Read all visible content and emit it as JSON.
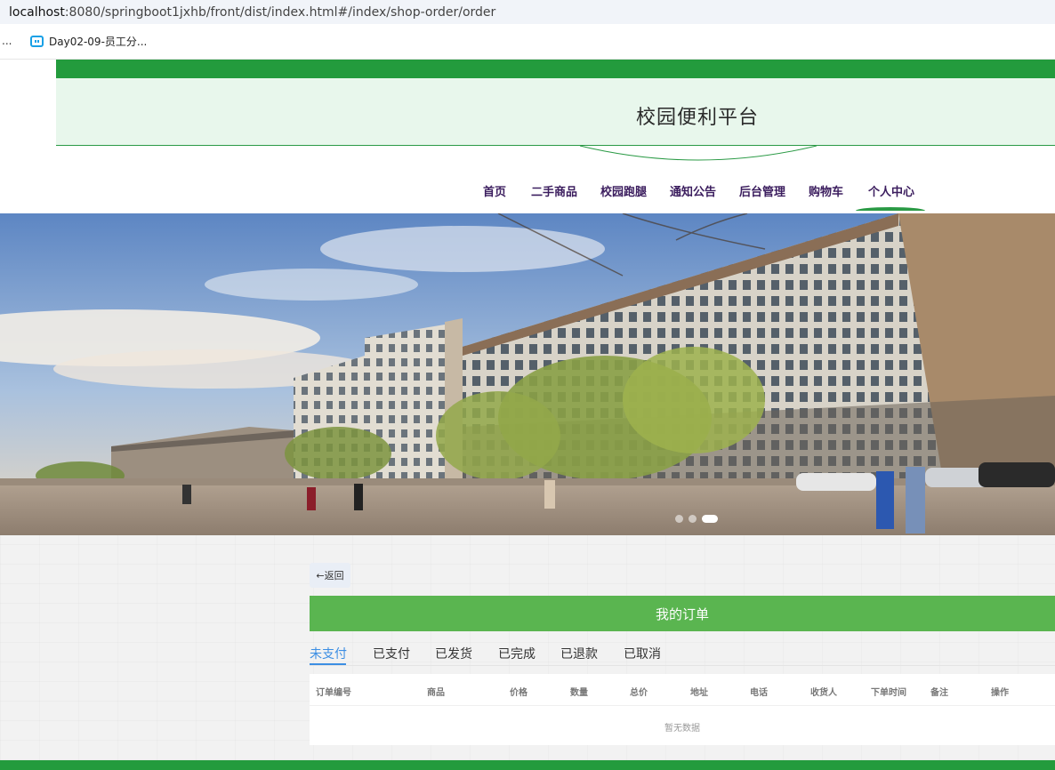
{
  "browser": {
    "url_host": "localhost",
    "url_rest": ":8080/springboot1jxhb/front/dist/index.html#/index/shop-order/order",
    "bookmark_ellipsis": "...",
    "bookmark_label": "Day02-09-员工分..."
  },
  "site": {
    "title": "校园便利平台",
    "nav": [
      "首页",
      "二手商品",
      "校园跑腿",
      "通知公告",
      "后台管理",
      "购物车",
      "个人中心"
    ],
    "active_nav": "个人中心",
    "theme_color": "#239b3d"
  },
  "banner": {
    "slide_count": 3,
    "active_slide": 3
  },
  "order": {
    "back_label": "←返回",
    "panel_title": "我的订单",
    "tabs": [
      "未支付",
      "已支付",
      "已发货",
      "已完成",
      "已退款",
      "已取消"
    ],
    "active_tab": "未支付",
    "columns": [
      "订单编号",
      "商品",
      "价格",
      "数量",
      "总价",
      "地址",
      "电话",
      "收货人",
      "下单时间",
      "备注",
      "操作"
    ],
    "empty_text": "暂无数据"
  }
}
